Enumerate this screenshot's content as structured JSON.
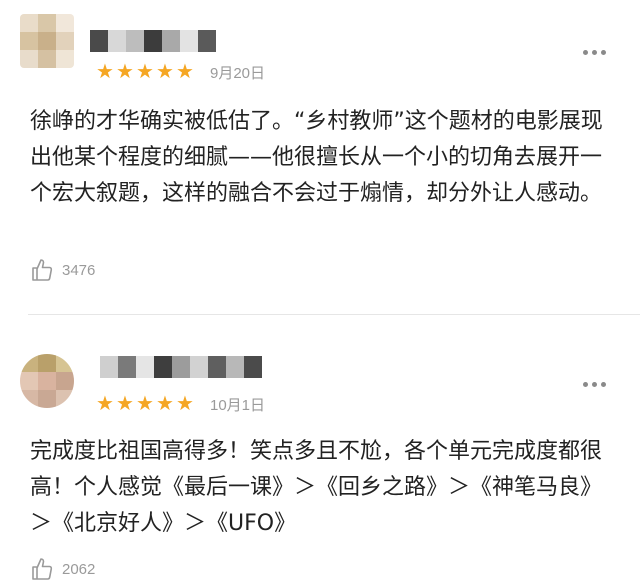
{
  "reviews": [
    {
      "rating": 5,
      "stars": [
        "★",
        "★",
        "★",
        "★",
        "★"
      ],
      "date": "9月20日",
      "content": "徐峥的才华确实被低估了。“乡村教师”这个题材的电影展现出他某个程度的细腻——他很擅长从一个小的切角去展开一个宏大叙题，这样的融合不会过于煽情，却分外让人感动。",
      "likes": "3476",
      "star_color": "#f5a623"
    },
    {
      "rating": 5,
      "stars": [
        "★",
        "★",
        "★",
        "★",
        "★"
      ],
      "date": "10月1日",
      "content": "完成度比祖国高得多！笑点多且不尬，各个单元完成度都很高！个人感觉《最后一课》＞《回乡之路》＞《神笔马良》＞《北京好人》＞《UFO》",
      "likes": "2062",
      "star_color": "#f5a623"
    }
  ],
  "icons": {
    "more": "more-dots-icon",
    "like": "thumbs-up-icon",
    "star": "star-icon"
  },
  "colors": {
    "star": "#f5a623",
    "meta_text": "#9a9a9a",
    "body_text": "#222222",
    "divider": "#e6e6e6"
  }
}
